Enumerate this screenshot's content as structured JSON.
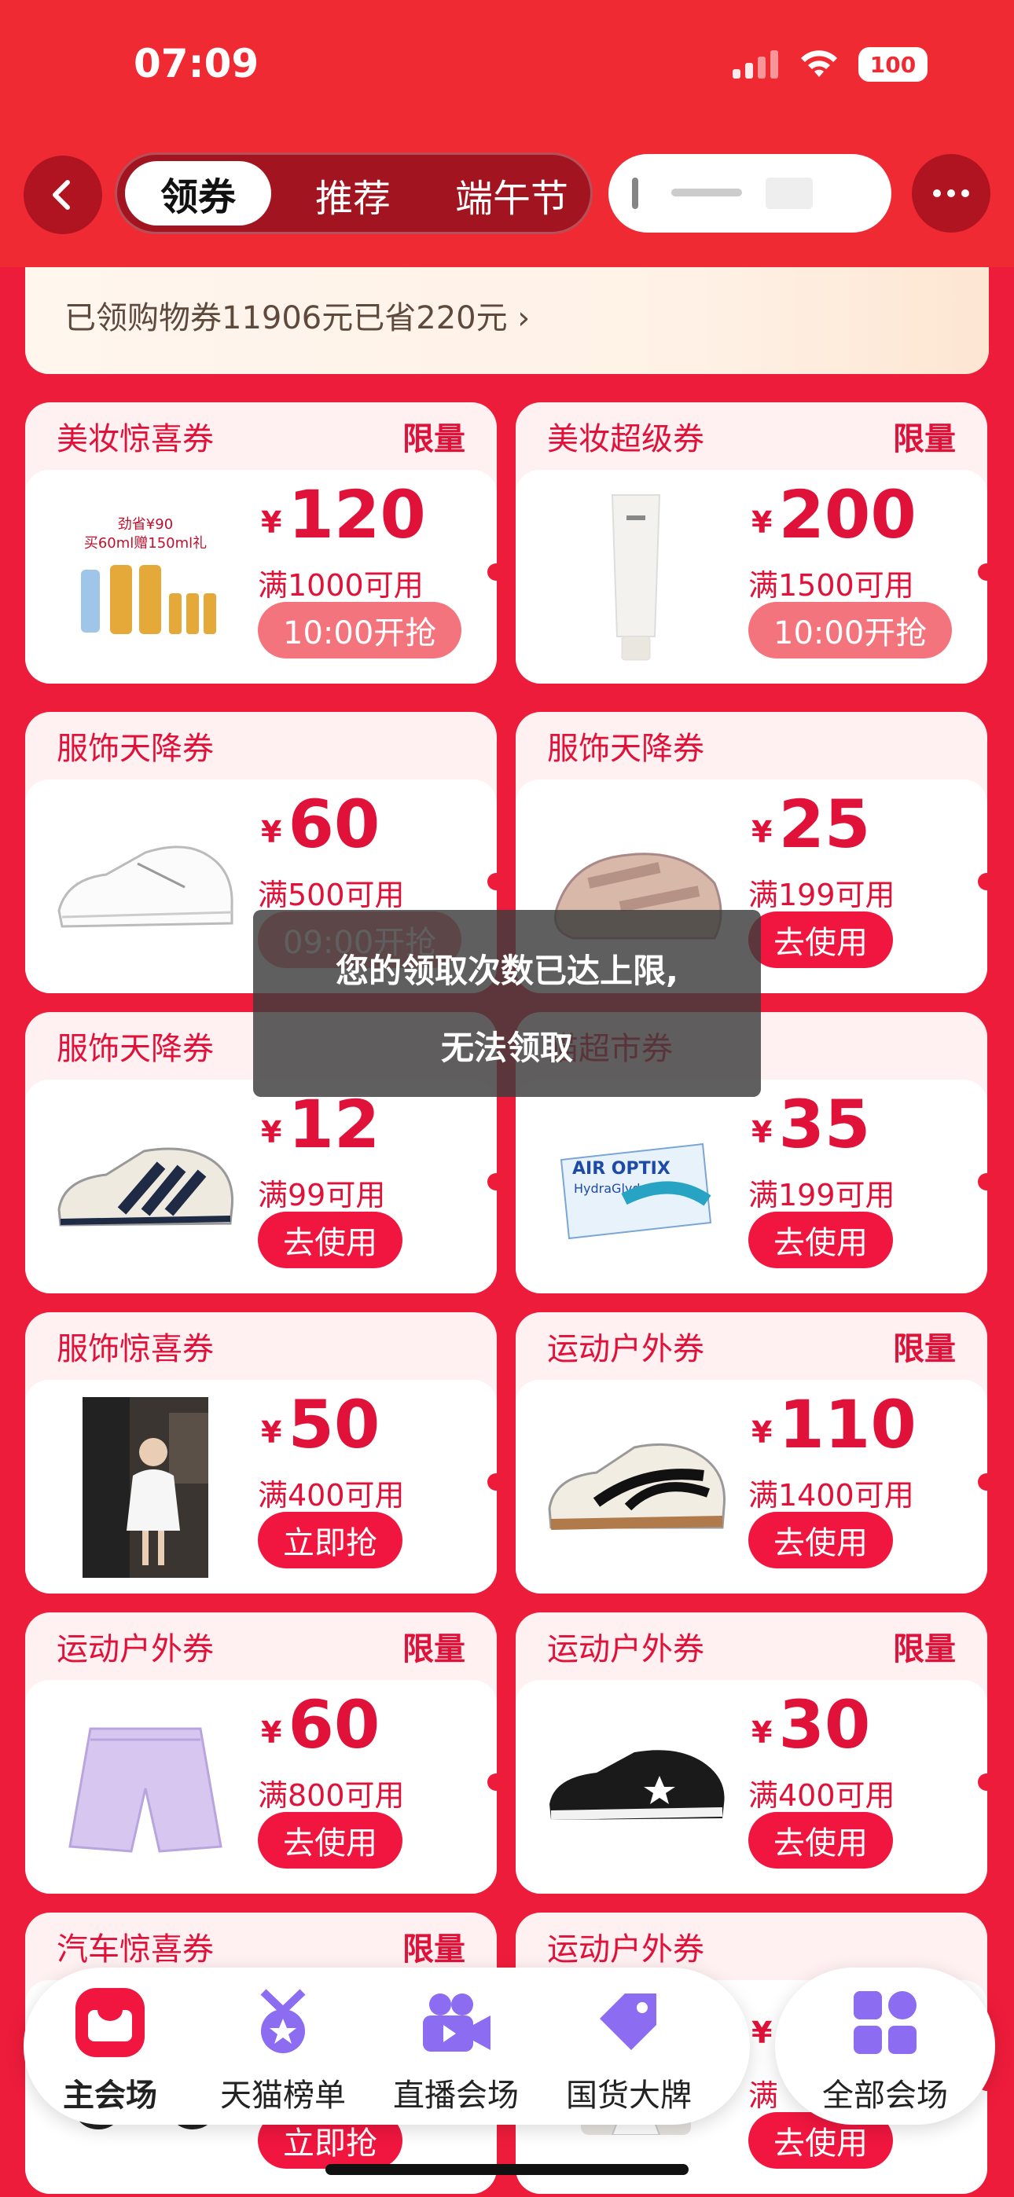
{
  "status": {
    "time": "07:09",
    "battery": "100"
  },
  "nav": {
    "tabs": [
      {
        "label": "领券"
      },
      {
        "label": "推荐"
      },
      {
        "label": "端午节"
      }
    ]
  },
  "savings": {
    "text": "已领购物券11906元已省220元 ›"
  },
  "coupons": [
    {
      "title": "美妆惊喜券",
      "badge": "限量",
      "currency": "¥",
      "amount": "120",
      "condition": "满1000可用",
      "button": "10:00开抢",
      "button_state": "timer",
      "thumb_caption_1": "劲省¥90",
      "thumb_caption_2": "买60ml赠150ml礼"
    },
    {
      "title": "美妆超级券",
      "badge": "限量",
      "currency": "¥",
      "amount": "200",
      "condition": "满1500可用",
      "button": "10:00开抢",
      "button_state": "timer"
    },
    {
      "title": "服饰天降券",
      "badge": "",
      "currency": "¥",
      "amount": "60",
      "condition": "满500可用",
      "button": "09:00开抢",
      "button_state": "timer"
    },
    {
      "title": "服饰天降券",
      "badge": "",
      "currency": "¥",
      "amount": "25",
      "condition": "满199可用",
      "button": "去使用",
      "button_state": "use"
    },
    {
      "title": "服饰天降券",
      "badge": "",
      "currency": "¥",
      "amount": "12",
      "condition": "满99可用",
      "button": "去使用",
      "button_state": "use"
    },
    {
      "title": "猫超市券",
      "badge": "",
      "currency": "¥",
      "amount": "35",
      "condition": "满199可用",
      "button": "去使用",
      "button_state": "use",
      "thumb_caption_1": "AIR OPTIX",
      "thumb_caption_2": "HydraGlyde"
    },
    {
      "title": "服饰惊喜券",
      "badge": "",
      "currency": "¥",
      "amount": "50",
      "condition": "满400可用",
      "button": "立即抢",
      "button_state": "grab"
    },
    {
      "title": "运动户外券",
      "badge": "限量",
      "currency": "¥",
      "amount": "110",
      "condition": "满1400可用",
      "button": "去使用",
      "button_state": "use"
    },
    {
      "title": "运动户外券",
      "badge": "限量",
      "currency": "¥",
      "amount": "60",
      "condition": "满800可用",
      "button": "去使用",
      "button_state": "use"
    },
    {
      "title": "运动户外券",
      "badge": "限量",
      "currency": "¥",
      "amount": "30",
      "condition": "满400可用",
      "button": "去使用",
      "button_state": "use"
    },
    {
      "title": "汽车惊喜券",
      "badge": "限量",
      "currency": "¥",
      "amount": "",
      "condition": "",
      "button": "立即抢",
      "button_state": "grab"
    },
    {
      "title": "运动户外券",
      "badge": "",
      "currency": "¥",
      "amount": "",
      "condition": "满",
      "button": "去使用",
      "button_state": "use"
    }
  ],
  "toast": {
    "line1": "您的领取次数已达上限,",
    "line2": "无法领取"
  },
  "tabbar": [
    {
      "label": "主会场",
      "icon": "tmall-main-icon"
    },
    {
      "label": "天猫榜单",
      "icon": "medal-icon"
    },
    {
      "label": "直播会场",
      "icon": "live-video-icon"
    },
    {
      "label": "国货大牌",
      "icon": "tag-icon"
    }
  ],
  "tab_all": {
    "label": "全部会场",
    "icon": "grid-icon"
  },
  "colors": {
    "brand_red": "#f02a32",
    "coupon_red": "#e0123a",
    "page_bg": "#ee1c3b"
  }
}
